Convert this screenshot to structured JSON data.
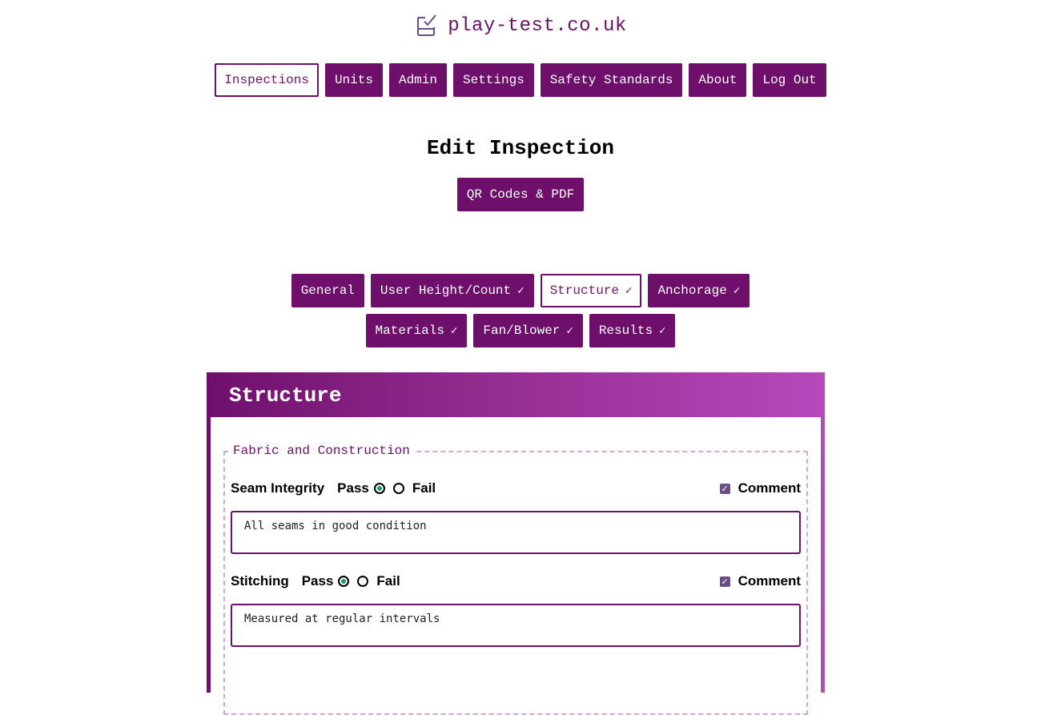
{
  "site": {
    "name": "play-test.co.uk",
    "logo_icon": "clipboard-check-icon"
  },
  "nav": {
    "items": [
      {
        "label": "Inspections",
        "active": true
      },
      {
        "label": "Units"
      },
      {
        "label": "Admin"
      },
      {
        "label": "Settings"
      },
      {
        "label": "Safety Standards"
      },
      {
        "label": "About"
      },
      {
        "label": "Log Out"
      }
    ]
  },
  "page": {
    "title": "Edit Inspection",
    "qr_button": "QR Codes & PDF"
  },
  "tabs": [
    {
      "label": "General",
      "check": ""
    },
    {
      "label": "User Height/Count",
      "check": "✓"
    },
    {
      "label": "Structure",
      "check": "✓",
      "active": true
    },
    {
      "label": "Anchorage",
      "check": "✓"
    },
    {
      "label": "Materials",
      "check": "✓"
    },
    {
      "label": "Fan/Blower",
      "check": "✓"
    },
    {
      "label": "Results",
      "check": "✓"
    }
  ],
  "section": {
    "title": "Structure",
    "fieldset_legend": "Fabric and Construction",
    "questions": [
      {
        "label": "Seam Integrity",
        "pass_label": "Pass",
        "fail_label": "Fail",
        "value": "pass",
        "comment_label": "Comment",
        "comment_checked": true,
        "comment": "All seams in good condition"
      },
      {
        "label": "Stitching",
        "pass_label": "Pass",
        "fail_label": "Fail",
        "value": "pass",
        "comment_label": "Comment",
        "comment_checked": true,
        "comment": "Measured at regular intervals"
      }
    ]
  },
  "colors": {
    "brand": "#6f0f6c",
    "pass_green": "#1aa05a"
  }
}
